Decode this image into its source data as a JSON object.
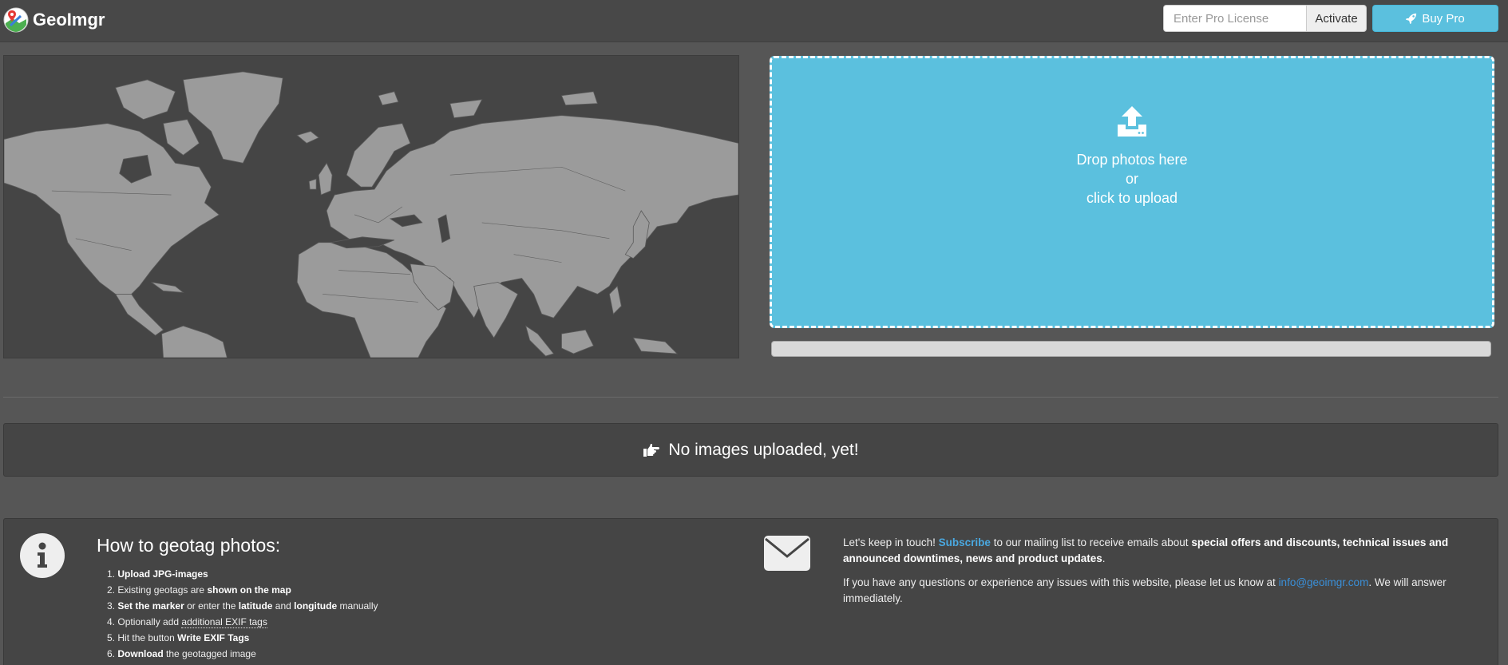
{
  "navbar": {
    "brand": "GeoImgr",
    "license_placeholder": "Enter Pro License",
    "activate_label": "Activate",
    "buy_pro_label": "Buy Pro"
  },
  "dropzone": {
    "line1": "Drop photos here",
    "line2": "or",
    "line3": "click to upload"
  },
  "upload_progress": 0,
  "no_images": "No images uploaded, yet!",
  "howto": {
    "title": "How to geotag photos:",
    "steps": [
      {
        "num": "1.",
        "bold": "Upload JPG-images",
        "rest": ""
      },
      {
        "num": "2.",
        "pre": "Existing geotags are ",
        "bold": "shown on the map"
      },
      {
        "num": "3.",
        "bold1": "Set the marker",
        "mid": " or enter the ",
        "bold2": "latitude",
        "mid2": " and ",
        "bold3": "longitude",
        "post": " manually"
      },
      {
        "num": "4.",
        "pre": "Optionally add ",
        "link": "additional EXIF tags"
      },
      {
        "num": "5.",
        "pre": "Hit the button ",
        "bold": "Write EXIF Tags"
      },
      {
        "num": "6.",
        "bold": "Download",
        "post": " the geotagged image"
      }
    ]
  },
  "contact": {
    "p1_pre": "Let's keep in touch! ",
    "p1_link": "Subscribe",
    "p1_mid": " to our mailing list to receive emails about ",
    "p1_bold": "special offers and discounts, technical issues and announced downtimes, news and product updates",
    "p1_post": ".",
    "p2_pre": "If you have any questions or experience any issues with this website, please let us know at ",
    "p2_email": "info@geoimgr.com",
    "p2_post": ". We will answer immediately."
  },
  "colors": {
    "background": "#565656",
    "navbar": "#484848",
    "accent": "#5bc0de",
    "panel": "#454545",
    "land": "#9b9b9b"
  },
  "icons": [
    "map-pin-logo-icon",
    "rocket-icon",
    "upload-icon",
    "hand-pointing-right-icon",
    "info-icon",
    "envelope-icon"
  ]
}
